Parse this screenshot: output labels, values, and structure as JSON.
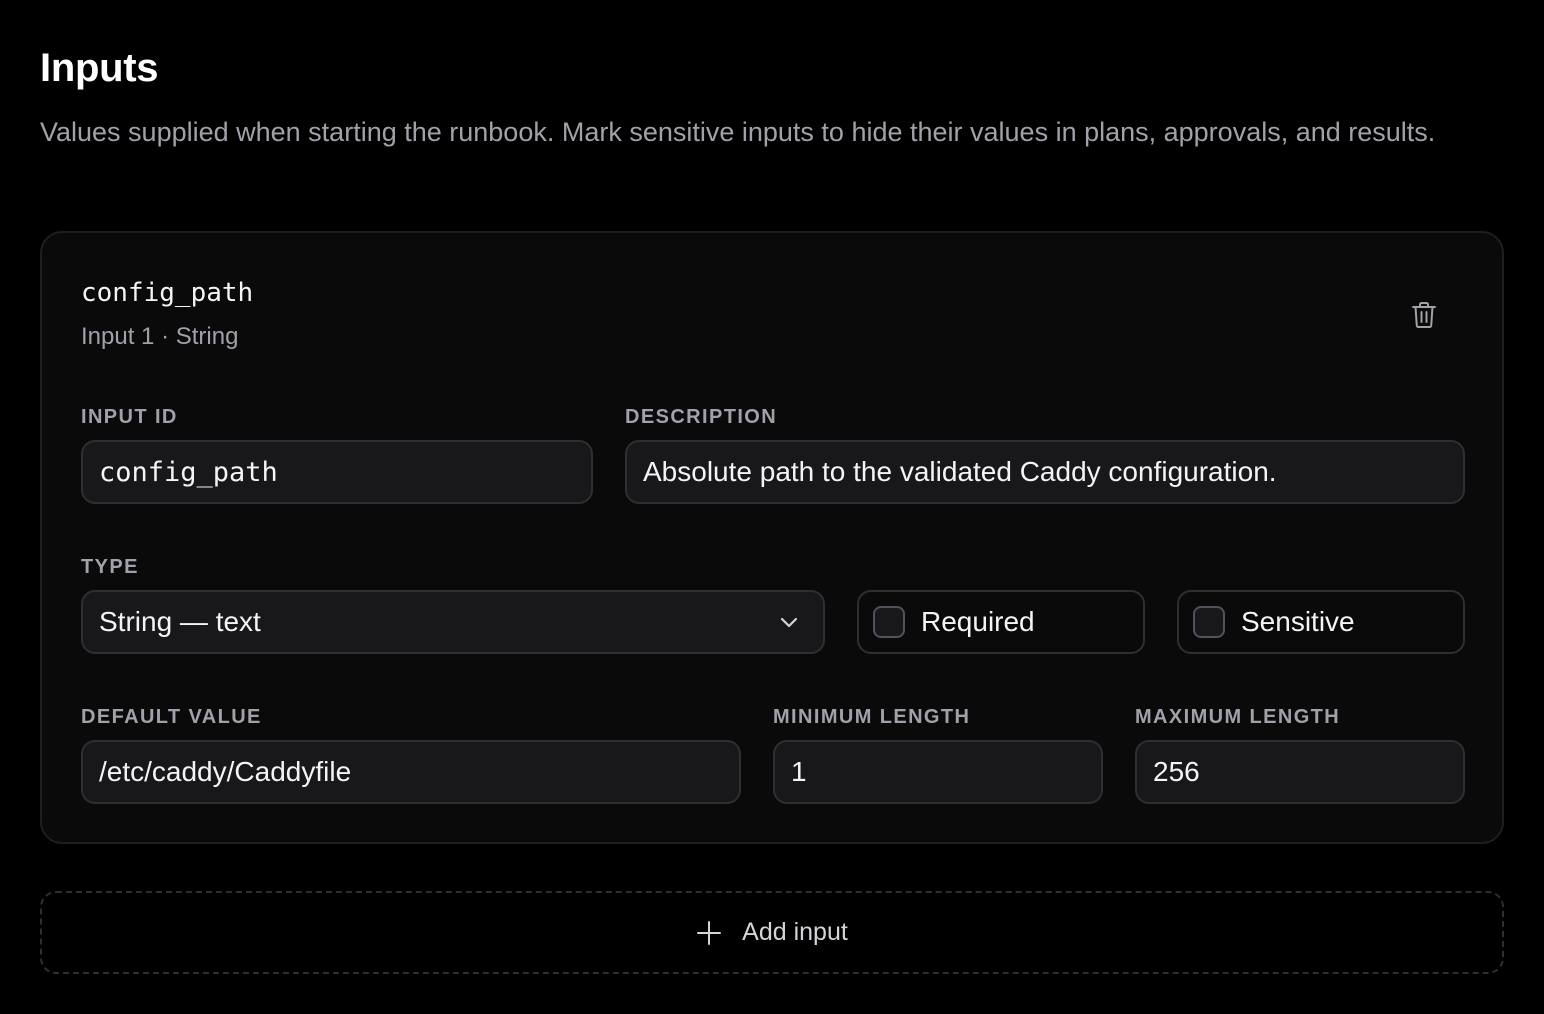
{
  "section": {
    "title": "Inputs",
    "description": "Values supplied when starting the runbook. Mark sensitive inputs to hide their values in plans, approvals, and results."
  },
  "input_card": {
    "name": "config_path",
    "meta": "Input 1 · String",
    "delete_icon": "trash-icon",
    "fields": {
      "input_id": {
        "label": "INPUT ID",
        "value": "config_path"
      },
      "description": {
        "label": "DESCRIPTION",
        "value": "Absolute path to the validated Caddy configuration."
      },
      "type": {
        "label": "TYPE",
        "selected": "String — text"
      },
      "required": {
        "label": "Required",
        "checked": false
      },
      "sensitive": {
        "label": "Sensitive",
        "checked": false
      },
      "default_value": {
        "label": "DEFAULT VALUE",
        "value": "/etc/caddy/Caddyfile"
      },
      "minimum_length": {
        "label": "MINIMUM LENGTH",
        "value": "1"
      },
      "maximum_length": {
        "label": "MAXIMUM LENGTH",
        "value": "256"
      }
    }
  },
  "add_button": {
    "label": "Add input",
    "icon": "plus-icon"
  },
  "colors": {
    "background": "#000000",
    "card": "#0a0a0b",
    "field": "#18181b",
    "border": "#2e2e33",
    "muted_text": "#a1a1aa"
  }
}
